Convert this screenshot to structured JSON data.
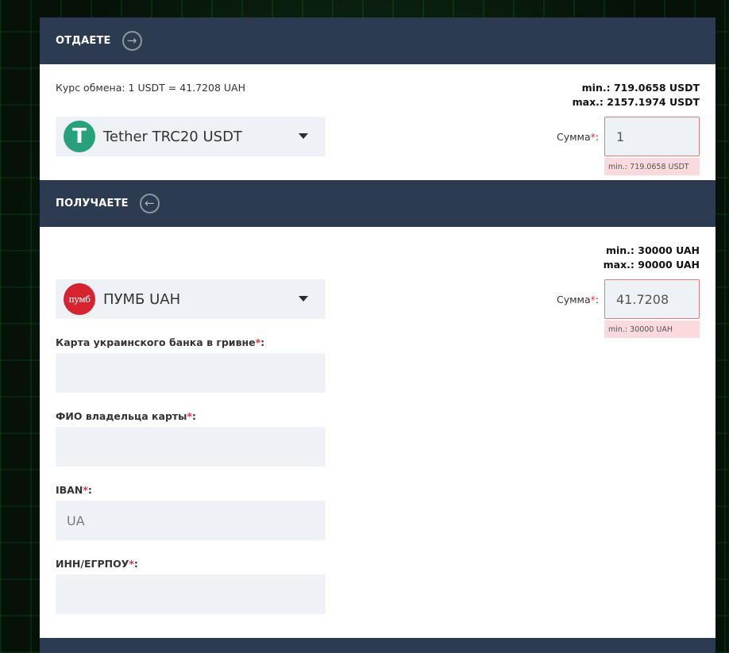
{
  "give": {
    "title": "ОТДАЕТЕ",
    "direction_icon": "arrow-right-circle-icon",
    "rate": "Курс обмена: 1 USDT = 41.7208 UAH",
    "min": "min.: 719.0658 USDT",
    "max": "max.: 2157.1974 USDT",
    "currency": {
      "name": "Tether TRC20 USDT",
      "logo_glyph": "T",
      "logo_color": "#26a17b"
    },
    "sum_label": "Сумма",
    "sum_required_mark": "*",
    "sum_label_suffix": ":",
    "sum_value": "1",
    "sum_error": "min.: 719.0658 USDT"
  },
  "receive": {
    "title": "ПОЛУЧАЕТЕ",
    "direction_icon": "arrow-left-circle-icon",
    "min": "min.: 30000 UAH",
    "max": "max.: 90000 UAH",
    "currency": {
      "name": "ПУМБ UAH",
      "logo_glyph": "пумб",
      "logo_color": "#d5232f"
    },
    "sum_label": "Сумма",
    "sum_required_mark": "*",
    "sum_label_suffix": ":",
    "sum_value": "41.7208",
    "sum_error": "min.: 30000 UAH"
  },
  "fields": [
    {
      "label": "Карта украинского банка в гривне",
      "required_mark": "*",
      "suffix": ":",
      "value": "",
      "placeholder": ""
    },
    {
      "label": "ФИО владельца карты",
      "required_mark": "*",
      "suffix": ":",
      "value": "",
      "placeholder": ""
    },
    {
      "label": "IBAN",
      "required_mark": "*",
      "suffix": ":",
      "value": "",
      "placeholder": "UA"
    },
    {
      "label": "ИНН/ЕГРПОУ",
      "required_mark": "*",
      "suffix": ":",
      "value": "",
      "placeholder": ""
    }
  ],
  "colors": {
    "header_bg": "#2c3b4f",
    "input_bg": "#eef1f5",
    "error_bg": "#fadadd",
    "required": "#e0333b"
  }
}
